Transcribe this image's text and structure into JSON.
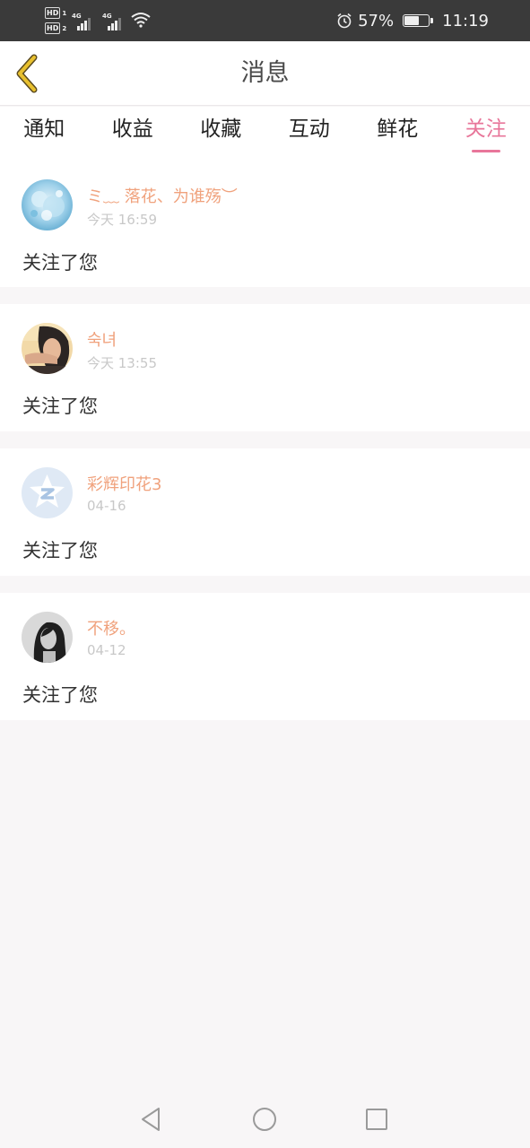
{
  "status_bar": {
    "hd1": "HD",
    "hd1_idx": "1",
    "hd2": "HD",
    "hd2_idx": "2",
    "net1": "4G",
    "net2": "4G",
    "battery_percent": "57%",
    "battery_level": 0.57,
    "time": "11:19"
  },
  "header": {
    "title": "消息",
    "back_icon": "chevron-left-icon",
    "accent_color": "#e8c02e"
  },
  "tabs": [
    {
      "label": "通知",
      "active": false
    },
    {
      "label": "收益",
      "active": false
    },
    {
      "label": "收藏",
      "active": false
    },
    {
      "label": "互动",
      "active": false
    },
    {
      "label": "鲜花",
      "active": false
    },
    {
      "label": "关注",
      "active": true
    }
  ],
  "messages": [
    {
      "name": "ミ﹏ 落花、为谁殇︶",
      "time": "今天 16:59",
      "text": "关注了您"
    },
    {
      "name": "숙녀",
      "time": "今天 13:55",
      "text": "关注了您"
    },
    {
      "name": "彩辉印花3",
      "time": "04-16",
      "text": "关注了您"
    },
    {
      "name": "不移。",
      "time": "04-12",
      "text": "关注了您"
    }
  ],
  "colors": {
    "active_tab": "#e8769a",
    "username": "#f0a27d",
    "timestamp": "#c8c8c8",
    "background": "#f8f6f7"
  }
}
